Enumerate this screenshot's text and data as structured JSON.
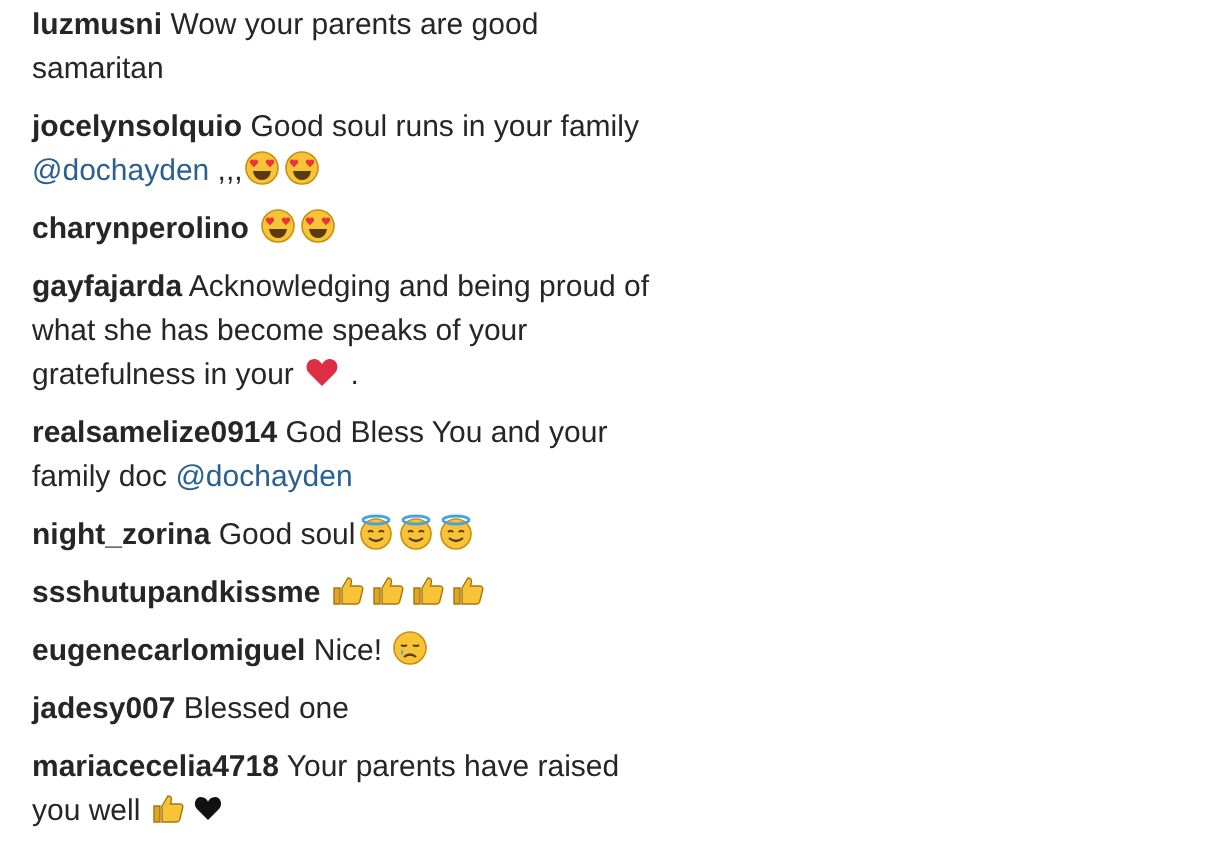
{
  "comments": [
    {
      "username": "luzmusni",
      "parts": [
        {
          "kind": "text",
          "text": "Wow your parents are good samaritan"
        }
      ]
    },
    {
      "username": "jocelynsolquio",
      "parts": [
        {
          "kind": "text",
          "text": "Good soul runs in your family "
        },
        {
          "kind": "mention",
          "text": "@dochayden"
        },
        {
          "kind": "text",
          "text": " ,,,"
        },
        {
          "kind": "heart-eyes"
        },
        {
          "kind": "heart-eyes"
        }
      ]
    },
    {
      "username": "charynperolino",
      "parts": [
        {
          "kind": "heart-eyes"
        },
        {
          "kind": "heart-eyes"
        }
      ]
    },
    {
      "username": "gayfajarda",
      "parts": [
        {
          "kind": "text",
          "text": "Acknowledging and being proud of what she has become speaks of your gratefulness in your "
        },
        {
          "kind": "red-heart"
        },
        {
          "kind": "text",
          "text": " ."
        }
      ]
    },
    {
      "username": "realsamelize0914",
      "parts": [
        {
          "kind": "text",
          "text": "God Bless You and your family doc "
        },
        {
          "kind": "mention",
          "text": "@dochayden"
        }
      ]
    },
    {
      "username": "night_zorina",
      "parts": [
        {
          "kind": "text",
          "text": "Good soul"
        },
        {
          "kind": "halo"
        },
        {
          "kind": "halo"
        },
        {
          "kind": "halo"
        }
      ]
    },
    {
      "username": "ssshutupandkissme",
      "parts": [
        {
          "kind": "thumbs-up"
        },
        {
          "kind": "thumbs-up"
        },
        {
          "kind": "thumbs-up"
        },
        {
          "kind": "thumbs-up"
        }
      ]
    },
    {
      "username": "eugenecarlomiguel",
      "parts": [
        {
          "kind": "text",
          "text": "Nice! "
        },
        {
          "kind": "sad"
        }
      ]
    },
    {
      "username": "jadesy007",
      "parts": [
        {
          "kind": "text",
          "text": "Blessed one"
        }
      ]
    },
    {
      "username": "mariacecelia4718",
      "parts": [
        {
          "kind": "text",
          "text": "Your parents have raised you well "
        },
        {
          "kind": "thumbs-up"
        },
        {
          "kind": "black-heart"
        }
      ]
    }
  ]
}
